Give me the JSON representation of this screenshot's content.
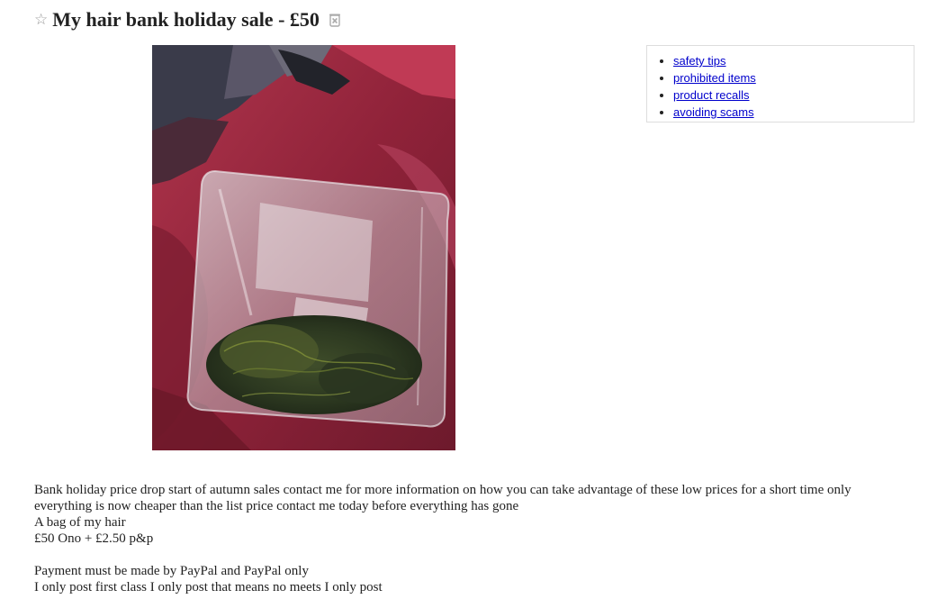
{
  "header": {
    "title": "My hair bank holiday sale - £50"
  },
  "icons": {
    "favorite": "star-icon",
    "hide": "hide-icon"
  },
  "photo": {
    "alt": "Clear plastic freezer bag containing hair on a red blanket"
  },
  "safety_links": [
    {
      "label": "safety tips"
    },
    {
      "label": "prohibited items"
    },
    {
      "label": "product recalls"
    },
    {
      "label": "avoiding scams"
    }
  ],
  "posting_body": {
    "line1": "Bank holiday price drop start of autumn sales contact me for more information on how you can take advantage of these low prices for a short time only",
    "line2": "everything is now cheaper than the list price contact me today before everything has gone",
    "line3": "A bag of my hair",
    "line4": "£50 Ono + £2.50 p&p",
    "line5": "Payment must be made by PayPal and PayPal only",
    "line6": "I only post first class I only post that means no meets I only post"
  },
  "colors": {
    "link": "#0000cc",
    "title": "#222222",
    "icon_gray": "#999999"
  }
}
